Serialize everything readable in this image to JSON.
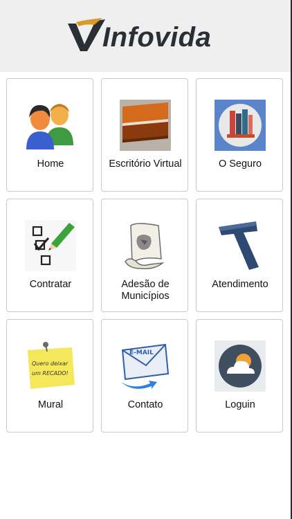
{
  "header": {
    "logo_text": "Infovida",
    "logo_letter": "V"
  },
  "menu": [
    {
      "label": "Home",
      "icon": "users-icon"
    },
    {
      "label": "Escritório Virtual",
      "icon": "book-icon"
    },
    {
      "label": "O Seguro",
      "icon": "books-shelf-icon"
    },
    {
      "label": "Contratar",
      "icon": "checklist-icon"
    },
    {
      "label": "Adesão de Municípios",
      "icon": "map-scroll-icon"
    },
    {
      "label": "Atendimento",
      "icon": "letter-t-icon"
    },
    {
      "label": "Mural",
      "icon": "sticky-note-icon"
    },
    {
      "label": "Contato",
      "icon": "email-icon"
    },
    {
      "label": "Loguin",
      "icon": "cloud-sun-icon"
    }
  ],
  "mural_note_text": "Quero deixar um RECADO!",
  "email_badge_text": "E-MAIL",
  "colors": {
    "header_bg": "#efefef",
    "logo_dark": "#2a2f36",
    "logo_gold": "#d89a2b",
    "tile_border": "#c9c9c9"
  }
}
